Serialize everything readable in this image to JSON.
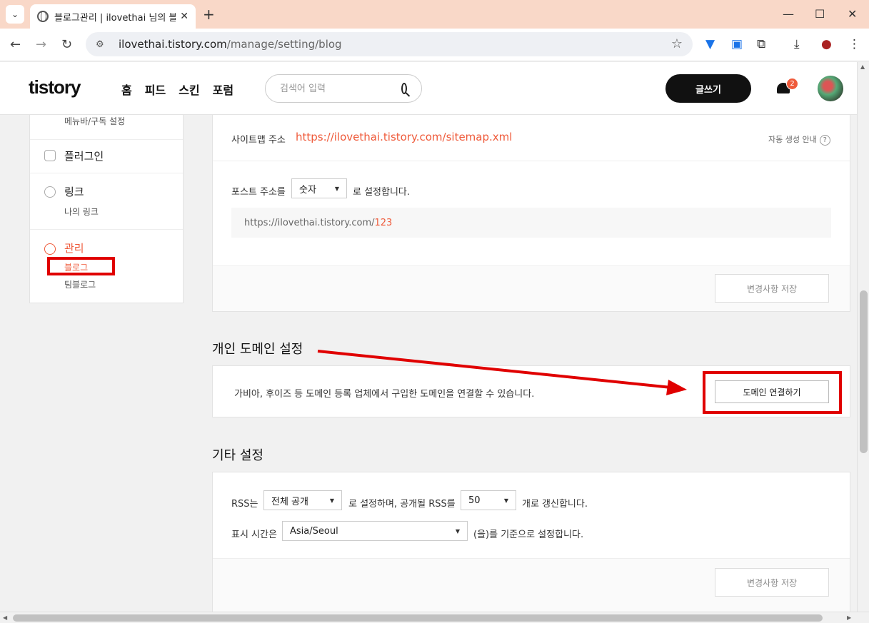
{
  "browser": {
    "tab_title": "블로그관리 | ilovethai 님의 블로그",
    "url_host": "ilovethai.tistory.com",
    "url_path": "/manage/setting/blog"
  },
  "header": {
    "logo": "tistory",
    "nav": [
      "홈",
      "피드",
      "스킨",
      "포럼"
    ],
    "search_placeholder": "검색어 입력",
    "write_label": "글쓰기",
    "notification_count": "2"
  },
  "sidebar": {
    "menu_sub": "메뉴바/구독 설정",
    "plugin": "플러그인",
    "link": "링크",
    "link_sub": "나의 링크",
    "manage": "관리",
    "manage_blog": "블로그",
    "manage_team": "팀블로그"
  },
  "url_settings": {
    "sitemap_label": "사이트맵 주소",
    "sitemap_url": "https://ilovethai.tistory.com/sitemap.xml",
    "auto_guide": "자동 생성 안내",
    "post_addr_prefix": "포스트 주소를",
    "post_addr_value": "숫자",
    "post_addr_suffix": "로 설정합니다.",
    "preview_base": "https://ilovethai.tistory.com/",
    "preview_num": "123",
    "save_label": "변경사항 저장"
  },
  "domain_settings": {
    "title": "개인 도메인 설정",
    "description": "가비아, 후이즈 등 도메인 등록 업체에서 구입한 도메인을 연결할 수 있습니다.",
    "connect_label": "도메인 연결하기"
  },
  "other_settings": {
    "title": "기타 설정",
    "rss_prefix": "RSS는",
    "rss_value": "전체 공개",
    "rss_middle": "로 설정하며, 공개될 RSS를",
    "rss_count": "50",
    "rss_suffix": "개로 갱신합니다.",
    "tz_prefix": "표시 시간은",
    "tz_value": "Asia/Seoul",
    "tz_suffix": "(을)를 기준으로 설정합니다.",
    "save_label": "변경사항 저장"
  },
  "colors": {
    "accent": "#ef5a3a",
    "annotation": "#e00000"
  }
}
